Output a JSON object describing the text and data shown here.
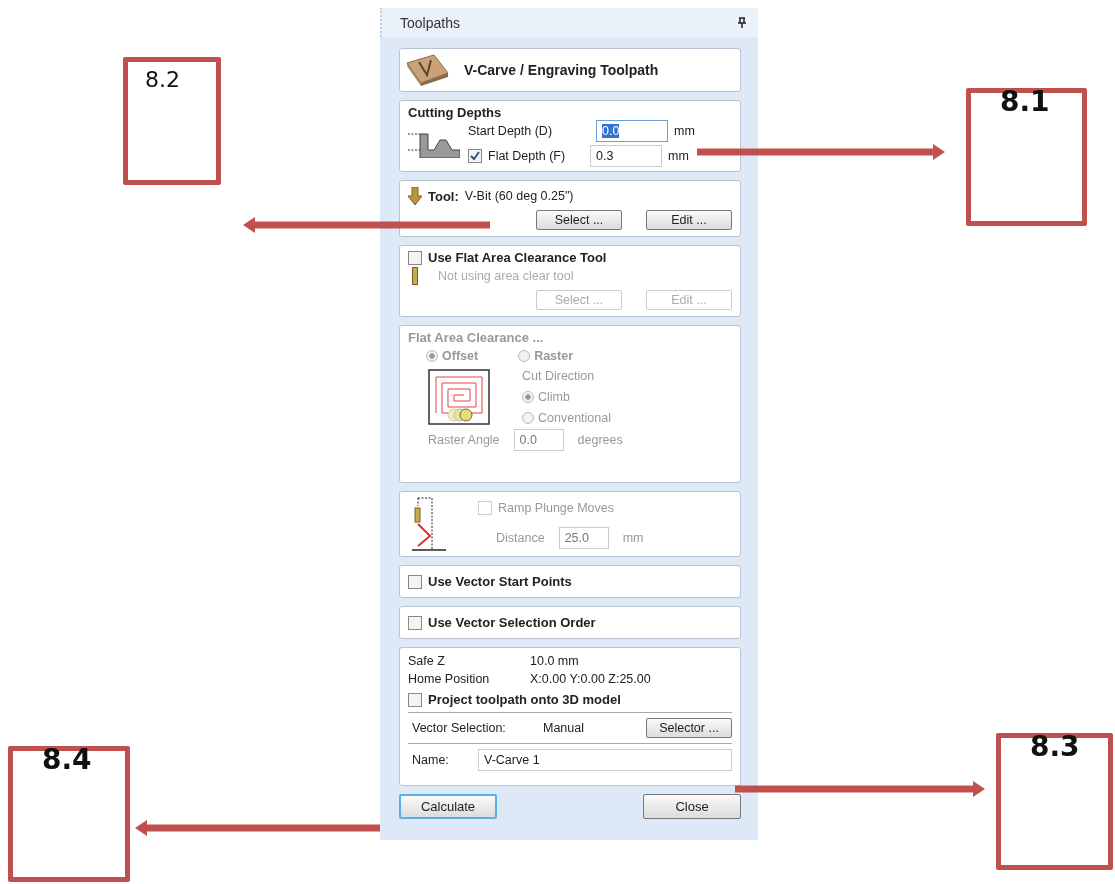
{
  "panel": {
    "title": "Toolpaths"
  },
  "header": {
    "title": "V-Carve / Engraving Toolpath"
  },
  "cutting_depths": {
    "title": "Cutting Depths",
    "start_depth": {
      "label": "Start Depth (D)",
      "value": "0.0",
      "unit": "mm",
      "selected": true
    },
    "flat_depth": {
      "label": "Flat Depth (F)",
      "checked": true,
      "value": "0.3",
      "unit": "mm"
    }
  },
  "tool": {
    "label": "Tool:",
    "value": "V-Bit (60 deg 0.25\")",
    "buttons": [
      "Select ...",
      "Edit ..."
    ]
  },
  "flat_area_tool": {
    "label": "Use Flat Area Clearance Tool",
    "checked": false,
    "status": "Not using area clear tool",
    "disabled": true,
    "buttons": [
      "Select ...",
      "Edit ..."
    ]
  },
  "flat_area_clearance": {
    "title": "Flat Area Clearance ...",
    "disabled": true,
    "strategies": [
      {
        "label": "Offset",
        "selected": true
      },
      {
        "label": "Raster",
        "selected": false
      }
    ],
    "cut_direction": "Cut Direction",
    "directions": [
      {
        "label": "Climb",
        "selected": true
      },
      {
        "label": "Conventional",
        "selected": false
      }
    ],
    "raster_angle": {
      "label": "Raster Angle",
      "value": "0.0",
      "unit": "degrees"
    }
  },
  "ramp": {
    "label": "Ramp Plunge Moves",
    "checked": false,
    "disabled": true,
    "distance": {
      "label": "Distance",
      "value": "25.0",
      "unit": "mm"
    }
  },
  "options": [
    {
      "label": "Use Vector Start Points",
      "checked": false
    },
    {
      "label": "Use Vector Selection Order",
      "checked": false
    }
  ],
  "settings": {
    "safe_z": {
      "label": "Safe Z",
      "value": "10.0 mm"
    },
    "home_position": {
      "label": "Home Position",
      "value": "X:0.00 Y:0.00 Z:25.00"
    },
    "project": {
      "label": "Project toolpath onto 3D model",
      "checked": false
    },
    "vector_selection": {
      "label": "Vector Selection:",
      "value": "Manual",
      "button": "Selector ..."
    },
    "name": {
      "label": "Name:",
      "value": "V-Carve 1"
    }
  },
  "buttons": [
    {
      "label": "Calculate",
      "focused": true
    },
    {
      "label": "Close",
      "focused": false
    }
  ],
  "annotations": [
    {
      "label": "8.2"
    },
    {
      "label": "8.1"
    },
    {
      "label": "8.4"
    },
    {
      "label": "8.3"
    }
  ]
}
